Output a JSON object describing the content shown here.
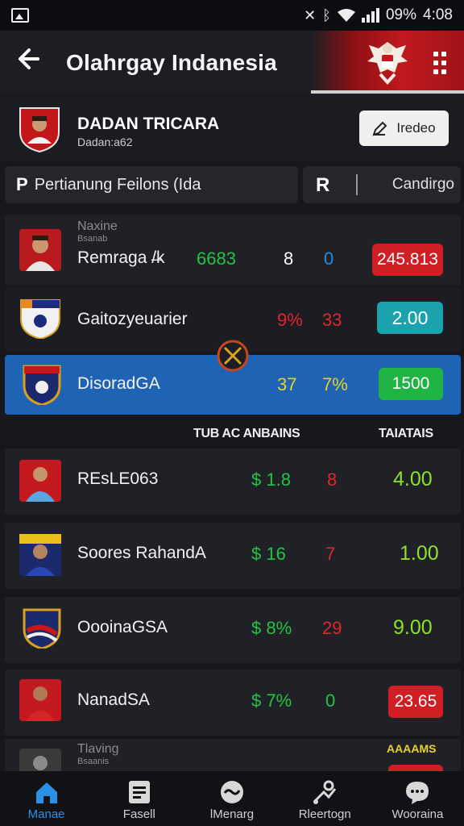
{
  "status_bar": {
    "battery": "09%",
    "time": "4:08"
  },
  "header": {
    "title": "Olahrgay  Indanesia"
  },
  "profile": {
    "name": "DADAN TRICARA",
    "subtitle": "Dadan:a62"
  },
  "edit_button": {
    "label": "Iredeo"
  },
  "search": {
    "icon_letter": "P",
    "value": "Pertianung Feilons (Ida"
  },
  "filter": {
    "icon_letter": "R",
    "label": "Candirgo"
  },
  "top_rows": [
    {
      "small1": "Naxine",
      "small2": "Bsanab",
      "name": "Remraga /̶k",
      "v1": "6683",
      "v2": "8",
      "v3": "0",
      "odds": "245.813",
      "accent": "#d3262a"
    },
    {
      "name": "Gaitozyeuarier",
      "v1": "9%",
      "v2": "33",
      "odds": "2.00",
      "accent": "#1aa3ad"
    },
    {
      "name": "DisoradGA",
      "v1": "37",
      "v2": "7%",
      "odds": "1500",
      "accent": "#20b445"
    }
  ],
  "section_labels": {
    "left": "TUB AC ANBAINS",
    "right": "TAIATAIS"
  },
  "bottom_rows": [
    {
      "name": "REsLE063",
      "v1": "$ 1.8",
      "v2": "8",
      "odds": "4.00"
    },
    {
      "name": "Soores RahandA",
      "v1": "$ 16",
      "v2": "7",
      "odds": "1.00"
    },
    {
      "name": "OooinaGSA",
      "v1": "$ 8%",
      "v2": "29",
      "odds": "9.00"
    },
    {
      "name": "NanadSA",
      "v1": "$ 7%",
      "v2": "0",
      "odds": "23.65"
    }
  ],
  "partial_row": {
    "small1": "Tlaving",
    "small2": "Bsaanis",
    "badge": "AAAAMS"
  },
  "bottom_nav": [
    {
      "label": "Manae",
      "icon": "home-icon",
      "active": true
    },
    {
      "label": "Fasell",
      "icon": "list-icon",
      "active": false
    },
    {
      "label": "lMenarg",
      "icon": "chat-wave-icon",
      "active": false
    },
    {
      "label": "Rleertogn",
      "icon": "tactics-icon",
      "active": false
    },
    {
      "label": "Wooraina",
      "icon": "message-icon",
      "active": false
    }
  ],
  "colors": {
    "accent_blue": "#1f63b5",
    "brand_red": "#c01a1d"
  }
}
